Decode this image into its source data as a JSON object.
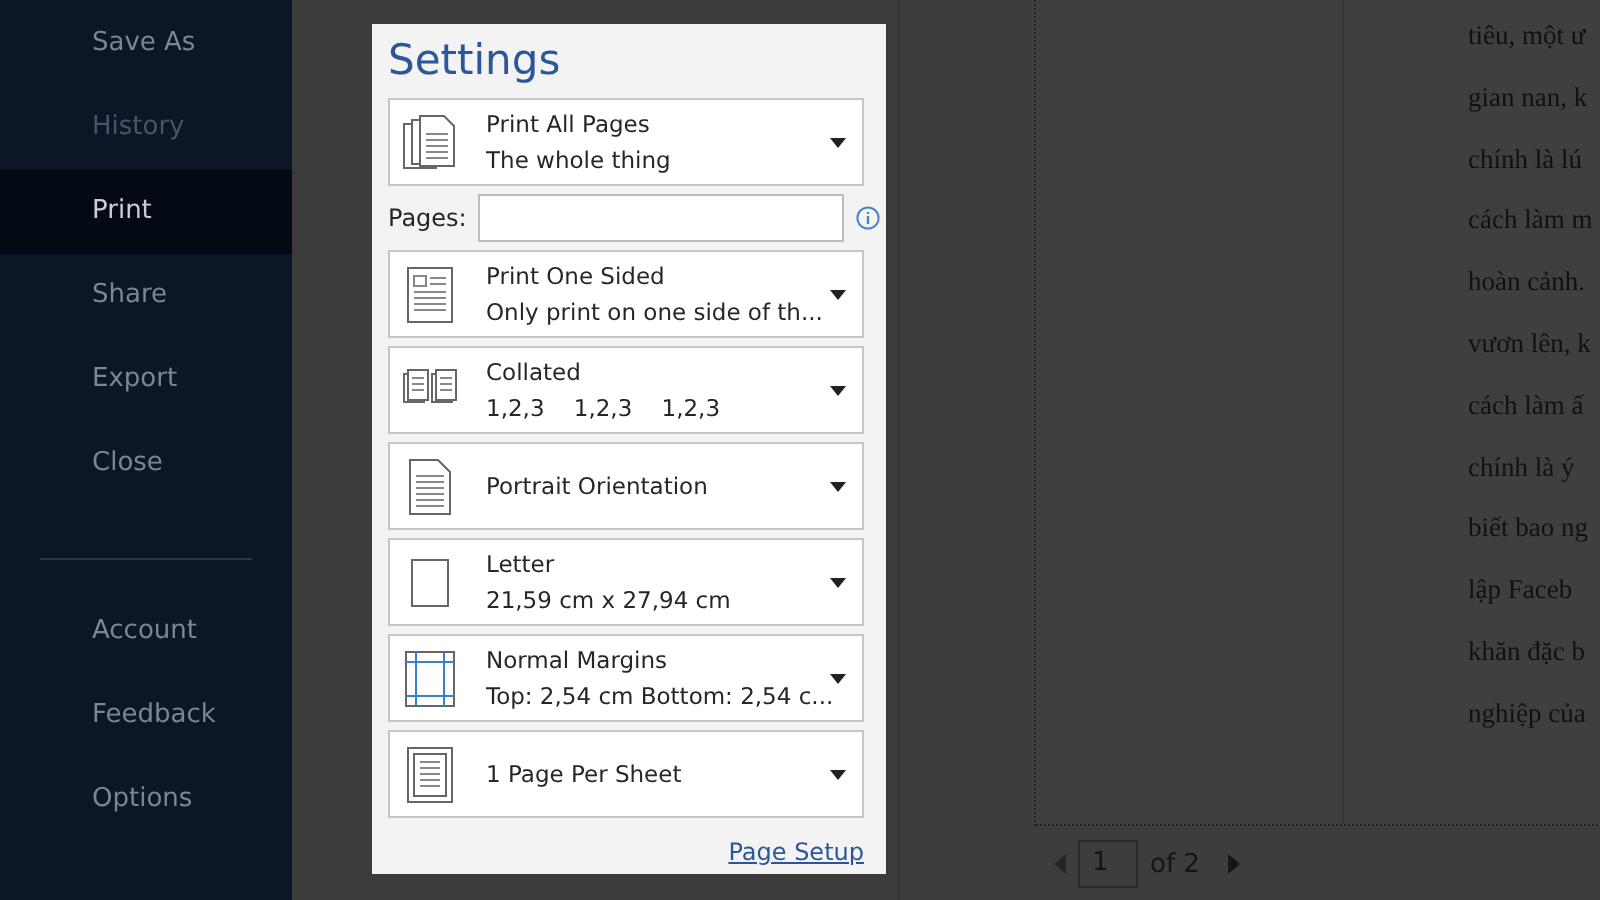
{
  "sidebar": {
    "items": [
      {
        "label": "Save As",
        "selected": false,
        "disabled": false
      },
      {
        "label": "History",
        "selected": false,
        "disabled": true
      },
      {
        "label": "Print",
        "selected": true,
        "disabled": false
      },
      {
        "label": "Share",
        "selected": false,
        "disabled": false
      },
      {
        "label": "Export",
        "selected": false,
        "disabled": false
      },
      {
        "label": "Close",
        "selected": false,
        "disabled": false
      }
    ],
    "bottom_items": [
      {
        "label": "Account",
        "selected": false,
        "disabled": false
      },
      {
        "label": "Feedback",
        "selected": false,
        "disabled": false
      },
      {
        "label": "Options",
        "selected": false,
        "disabled": false
      }
    ]
  },
  "settings": {
    "title": "Settings",
    "options": [
      {
        "kind": "pages",
        "title": "Print All Pages",
        "subtitle": "The whole thing"
      },
      {
        "kind": "sided",
        "title": "Print One Sided",
        "subtitle": "Only print on one side of th..."
      },
      {
        "kind": "collated",
        "title": "Collated",
        "subtitle": "1,2,3    1,2,3    1,2,3"
      },
      {
        "kind": "orientation",
        "title": "Portrait Orientation"
      },
      {
        "kind": "paper",
        "title": "Letter",
        "subtitle": "21,59 cm x 27,94 cm"
      },
      {
        "kind": "margins",
        "title": "Normal Margins",
        "subtitle": "Top: 2,54 cm Bottom: 2,54 c..."
      },
      {
        "kind": "sheet",
        "title": "1 Page Per Sheet"
      }
    ],
    "pages_field": {
      "label": "Pages:"
    },
    "link": "Page Setup"
  },
  "preview": {
    "lines": [
      "tiêu, một ư",
      "gian nan, k",
      "chính là lú",
      "cách làm m",
      "hoàn cảnh.",
      "vươn lên, k",
      "cách làm ấ",
      "chính là ý",
      "biết bao ng",
      "lập Faceb",
      "khăn đặc b",
      "nghiệp của"
    ],
    "page_number": "1",
    "page_total": "of 2"
  }
}
